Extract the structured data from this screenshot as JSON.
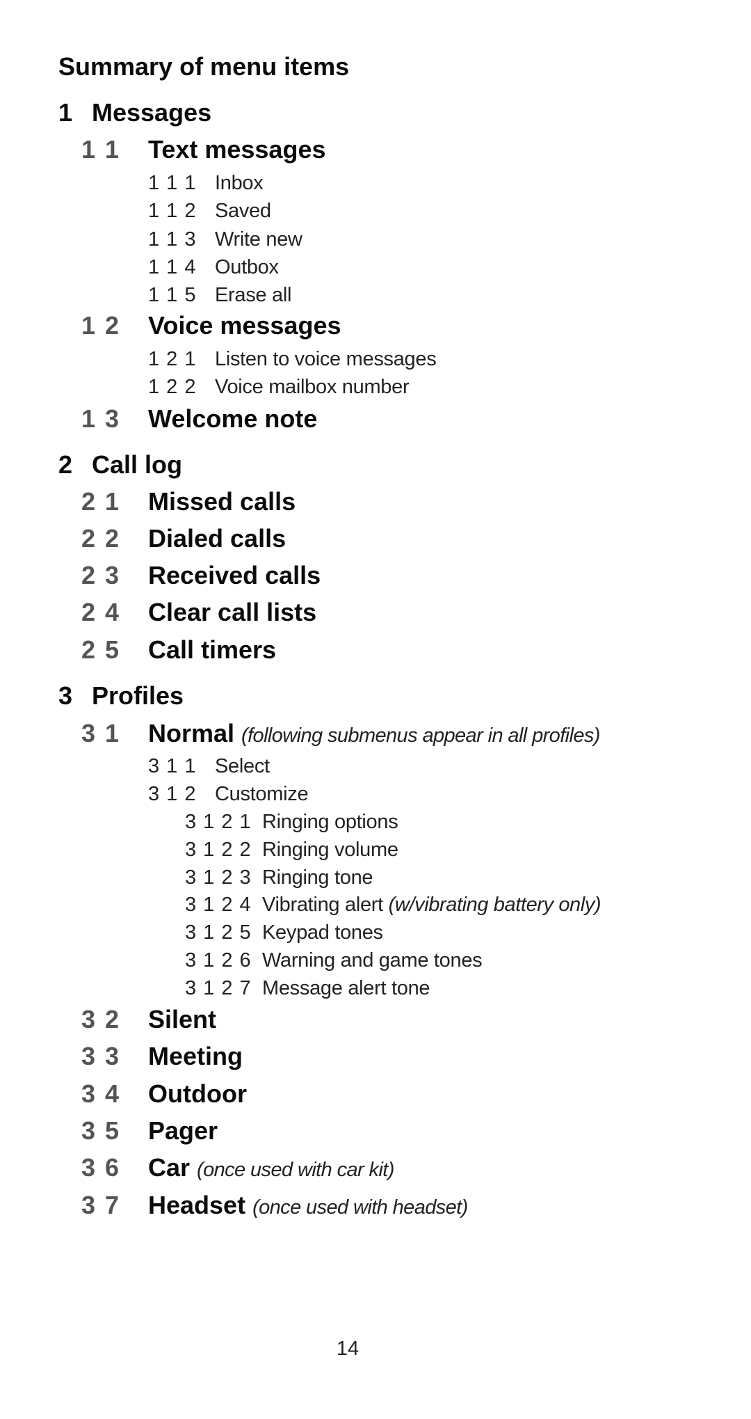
{
  "page": {
    "title": "Summary of menu items",
    "page_number": "14"
  },
  "menu": [
    {
      "number": "1",
      "label": "Messages",
      "children": [
        {
          "number": "1 1",
          "label": "Text messages",
          "children": [
            {
              "number": "1 1 1",
              "label": "Inbox"
            },
            {
              "number": "1 1 2",
              "label": "Saved"
            },
            {
              "number": "1 1 3",
              "label": "Write new"
            },
            {
              "number": "1 1 4",
              "label": "Outbox"
            },
            {
              "number": "1 1 5",
              "label": "Erase all"
            }
          ]
        },
        {
          "number": "1 2",
          "label": "Voice messages",
          "children": [
            {
              "number": "1 2 1",
              "label": "Listen to voice messages"
            },
            {
              "number": "1 2 2",
              "label": "Voice mailbox number"
            }
          ]
        },
        {
          "number": "1 3",
          "label": "Welcome note"
        }
      ]
    },
    {
      "number": "2",
      "label": "Call log",
      "children": [
        {
          "number": "2 1",
          "label": "Missed calls"
        },
        {
          "number": "2 2",
          "label": "Dialed calls"
        },
        {
          "number": "2 3",
          "label": "Received calls"
        },
        {
          "number": "2 4",
          "label": "Clear call lists"
        },
        {
          "number": "2 5",
          "label": "Call timers"
        }
      ]
    },
    {
      "number": "3",
      "label": "Profiles",
      "children": [
        {
          "number": "3 1",
          "label": "Normal",
          "note": "(following submenus appear in all profiles)",
          "children": [
            {
              "number": "3 1 1",
              "label": "Select"
            },
            {
              "number": "3 1 2",
              "label": "Customize",
              "children": [
                {
                  "number": "3 1 2 1",
                  "label": "Ringing options"
                },
                {
                  "number": "3 1 2 2",
                  "label": "Ringing volume"
                },
                {
                  "number": "3 1 2 3",
                  "label": "Ringing tone"
                },
                {
                  "number": "3 1 2 4",
                  "label": "Vibrating alert",
                  "note": "(w/vibrating battery only)"
                },
                {
                  "number": "3 1 2 5",
                  "label": "Keypad tones"
                },
                {
                  "number": "3 1 2 6",
                  "label": "Warning and game tones"
                },
                {
                  "number": "3 1 2 7",
                  "label": "Message alert tone"
                }
              ]
            }
          ]
        },
        {
          "number": "3 2",
          "label": "Silent"
        },
        {
          "number": "3 3",
          "label": "Meeting"
        },
        {
          "number": "3 4",
          "label": "Outdoor"
        },
        {
          "number": "3 5",
          "label": "Pager"
        },
        {
          "number": "3 6",
          "label": "Car",
          "note": "(once used with car kit)"
        },
        {
          "number": "3 7",
          "label": "Headset",
          "note": "(once used with headset)"
        }
      ]
    }
  ]
}
